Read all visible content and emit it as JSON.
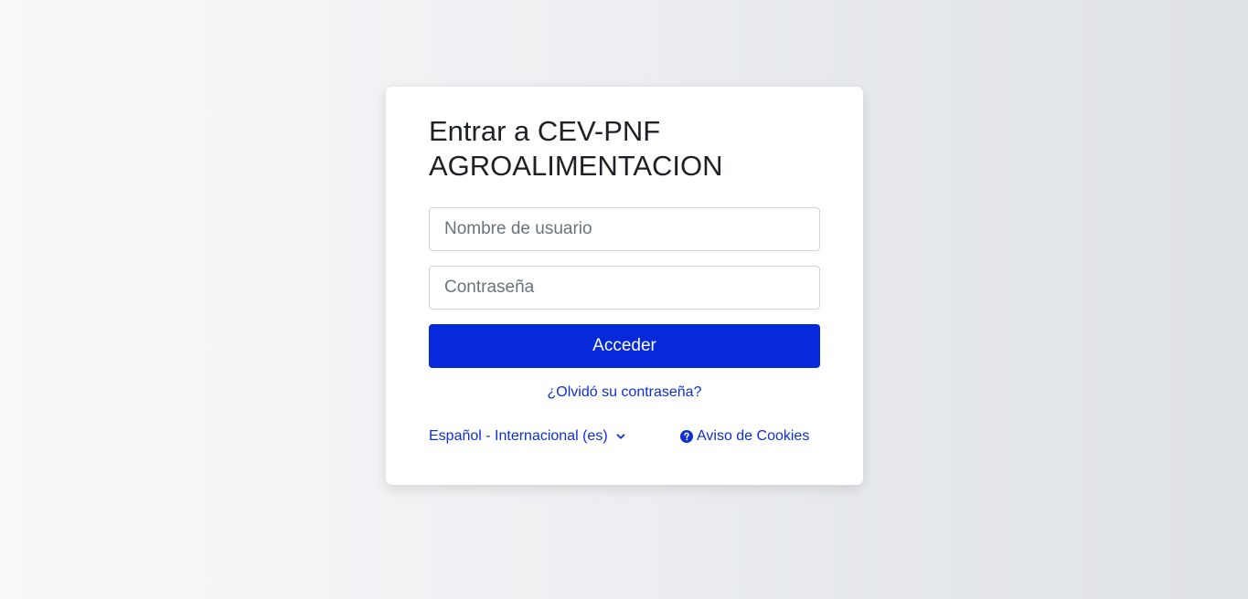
{
  "login": {
    "title": "Entrar a CEV-PNF AGROALIMENTACION",
    "username_placeholder": "Nombre de usuario",
    "password_placeholder": "Contraseña",
    "submit_label": "Acceder",
    "forgot_password": "¿Olvidó su contraseña?"
  },
  "footer": {
    "language": "Español - Internacional (es)",
    "language_icon": "chevron-down-icon",
    "cookies": "Aviso de Cookies",
    "cookies_icon": "question-circle-icon"
  },
  "colors": {
    "primary": "#0529db",
    "link": "#0f2fd0"
  }
}
